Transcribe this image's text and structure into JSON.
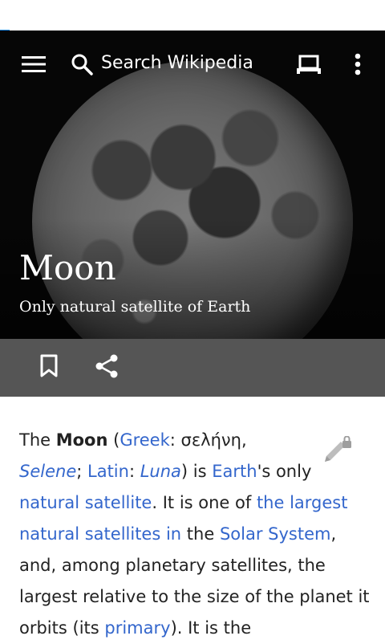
{
  "toolbar": {
    "search_placeholder": "Search Wikipedia",
    "icons": [
      "menu-icon",
      "search-icon",
      "reading-list-icon",
      "more-vert-icon"
    ]
  },
  "hero": {
    "title": "Moon",
    "description": "Only natural satellite of Earth"
  },
  "actions": {
    "icons": [
      "bookmark-icon",
      "share-icon"
    ]
  },
  "article": {
    "edit_icon": "edit-locked-icon",
    "t1": "The ",
    "b1": "Moon",
    "t2": " (",
    "l_greek": "Greek",
    "t3": ": σελήνη, ",
    "l_selene": "Selene",
    "t4": "; ",
    "l_latin": "Latin",
    "t5": ": ",
    "l_luna": "Luna",
    "t6": ") is ",
    "l_earth": "Earth",
    "t7": "'s only ",
    "l_natsat": "natural satellite",
    "t8": ". It is one of ",
    "l_largest": "the largest natural satellites in",
    "t9": " the ",
    "l_solar": "Solar System",
    "t10": ", and, among planetary satellites, the largest relative to the size of the planet it orbits (its ",
    "l_primary": "primary",
    "t11": "). It is the"
  },
  "colors": {
    "link": "#3366cc",
    "action_bar": "#555555",
    "text": "#222222"
  }
}
